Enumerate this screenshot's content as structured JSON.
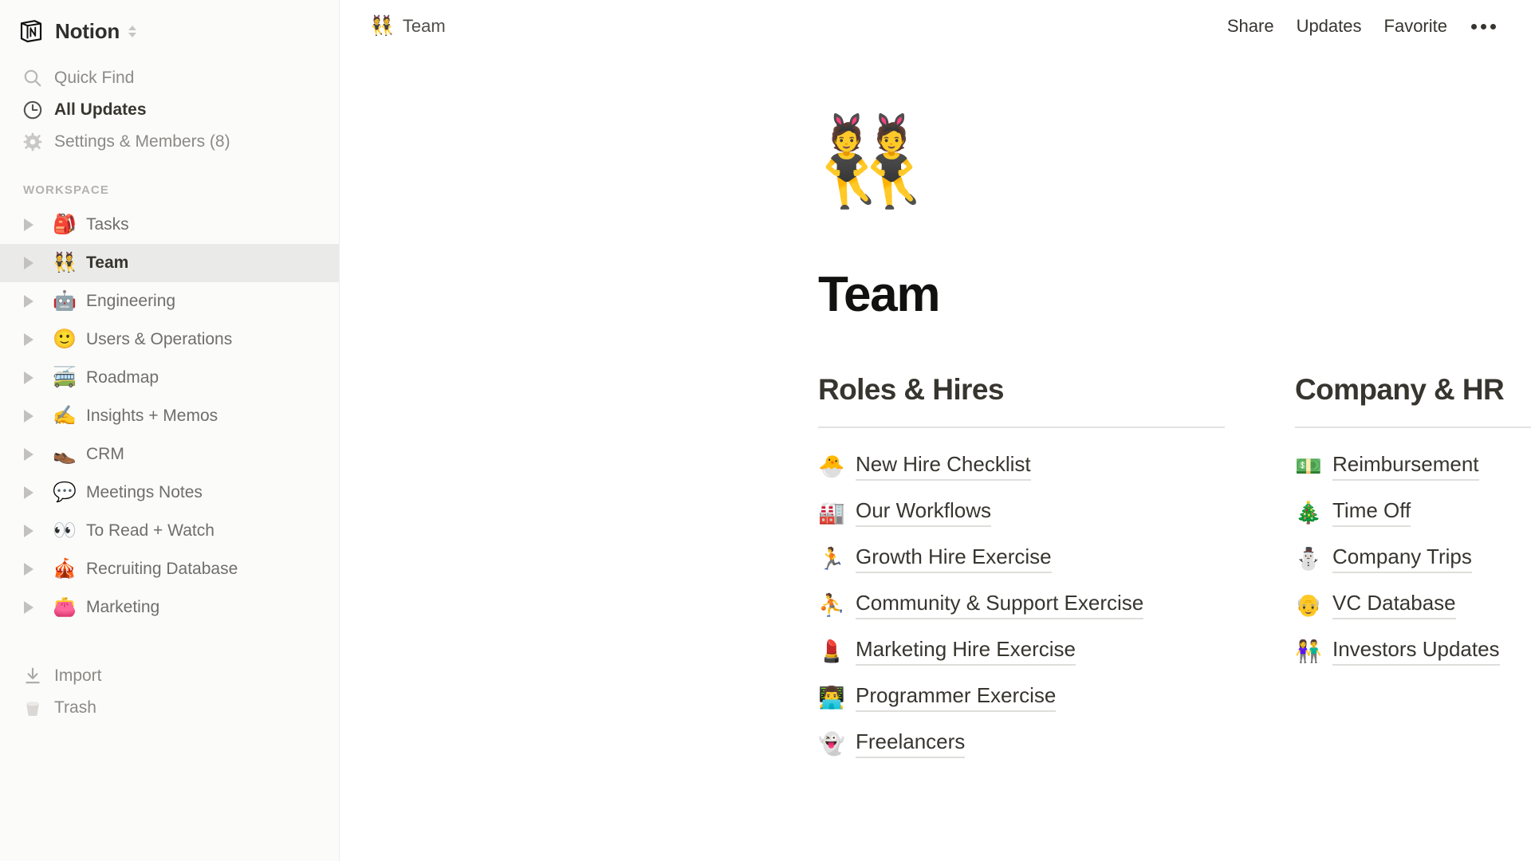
{
  "sidebar": {
    "workspace": {
      "name": "Notion",
      "logo_icon": "notion-logo-icon",
      "switcher_icon": "chevron-up-down-icon"
    },
    "top_nav": [
      {
        "label": "Quick Find",
        "icon": "search-icon",
        "strong": false
      },
      {
        "label": "All Updates",
        "icon": "clock-icon",
        "strong": true
      },
      {
        "label": "Settings & Members (8)",
        "icon": "gear-icon",
        "strong": false
      }
    ],
    "section_label": "WORKSPACE",
    "pages": [
      {
        "label": "Tasks",
        "emoji": "🎒",
        "active": false
      },
      {
        "label": "Team",
        "emoji": "👯",
        "active": true
      },
      {
        "label": "Engineering",
        "emoji": "🤖",
        "active": false
      },
      {
        "label": "Users & Operations",
        "emoji": "🙂",
        "active": false
      },
      {
        "label": "Roadmap",
        "emoji": "🚎",
        "active": false
      },
      {
        "label": "Insights + Memos",
        "emoji": "✍️",
        "active": false
      },
      {
        "label": "CRM",
        "emoji": "👞",
        "active": false
      },
      {
        "label": "Meetings Notes",
        "emoji": "💬",
        "active": false
      },
      {
        "label": "To Read + Watch",
        "emoji": "👀",
        "active": false
      },
      {
        "label": "Recruiting Database",
        "emoji": "🎪",
        "active": false
      },
      {
        "label": "Marketing",
        "emoji": "👛",
        "active": false
      }
    ],
    "bottom_nav": [
      {
        "label": "Import",
        "icon": "download-icon"
      },
      {
        "label": "Trash",
        "icon": "trash-icon"
      }
    ]
  },
  "topbar": {
    "breadcrumb": {
      "emoji": "👯",
      "label": "Team"
    },
    "actions": [
      {
        "label": "Share"
      },
      {
        "label": "Updates"
      },
      {
        "label": "Favorite"
      }
    ],
    "more_icon": "ellipsis-icon"
  },
  "page": {
    "icon": "👯",
    "title": "Team",
    "columns": [
      {
        "heading": "Roles & Hires",
        "links": [
          {
            "emoji": "🐣",
            "label": "New Hire Checklist"
          },
          {
            "emoji": "🏭",
            "label": "Our Workflows"
          },
          {
            "emoji": "🏃",
            "label": "Growth Hire Exercise"
          },
          {
            "emoji": "⛹️",
            "label": "Community & Support Exercise"
          },
          {
            "emoji": "💄",
            "label": "Marketing Hire Exercise"
          },
          {
            "emoji": "👨‍💻",
            "label": "Programmer Exercise"
          },
          {
            "emoji": "👻",
            "label": "Freelancers"
          }
        ]
      },
      {
        "heading": "Company & HR",
        "links": [
          {
            "emoji": "💵",
            "label": "Reimbursement"
          },
          {
            "emoji": "🎄",
            "label": "Time Off"
          },
          {
            "emoji": "⛄",
            "label": "Company Trips"
          },
          {
            "emoji": "👴",
            "label": "VC Database"
          },
          {
            "emoji": "👫",
            "label": "Investors Updates"
          }
        ]
      }
    ]
  },
  "colors": {
    "sidebar_bg": "#fbfbfa",
    "content_bg": "#ffffff",
    "active_row_bg": "#eaeae8",
    "text_primary": "#37352f",
    "text_muted": "#8b8a85",
    "rule": "#e3e2e0"
  }
}
